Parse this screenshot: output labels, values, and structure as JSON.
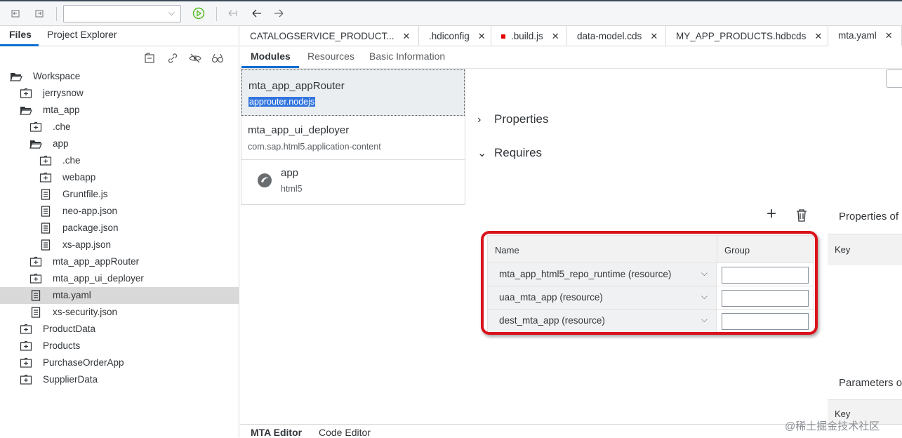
{
  "toolbar": {
    "icons": [
      "undo-icon",
      "redo-icon",
      "run-icon",
      "previous-edit-icon",
      "back-icon",
      "forward-icon"
    ],
    "selector_value": ""
  },
  "left_panel": {
    "tabs": [
      {
        "label": "Files",
        "active": true
      },
      {
        "label": "Project Explorer",
        "active": false
      }
    ],
    "tools": [
      "collapse-all-icon",
      "link-editor-icon",
      "hide-hidden-files-icon",
      "search-files-icon"
    ],
    "tree": [
      {
        "label": "Workspace",
        "type": "folder-open",
        "level": 0
      },
      {
        "label": "jerrysnow",
        "type": "project",
        "level": 1
      },
      {
        "label": "mta_app",
        "type": "folder-open",
        "level": 1
      },
      {
        "label": ".che",
        "type": "project",
        "level": 2
      },
      {
        "label": "app",
        "type": "folder-open",
        "level": 2
      },
      {
        "label": ".che",
        "type": "project",
        "level": 3
      },
      {
        "label": "webapp",
        "type": "project",
        "level": 3
      },
      {
        "label": "Gruntfile.js",
        "type": "file",
        "level": 3
      },
      {
        "label": "neo-app.json",
        "type": "file",
        "level": 3
      },
      {
        "label": "package.json",
        "type": "file",
        "level": 3
      },
      {
        "label": "xs-app.json",
        "type": "file",
        "level": 3
      },
      {
        "label": "mta_app_appRouter",
        "type": "project",
        "level": 2
      },
      {
        "label": "mta_app_ui_deployer",
        "type": "project",
        "level": 2
      },
      {
        "label": "mta.yaml",
        "type": "file",
        "level": 2,
        "selected": true
      },
      {
        "label": "xs-security.json",
        "type": "file",
        "level": 2
      },
      {
        "label": "ProductData",
        "type": "project",
        "level": 1
      },
      {
        "label": "Products",
        "type": "project",
        "level": 1
      },
      {
        "label": "PurchaseOrderApp",
        "type": "project",
        "level": 1
      },
      {
        "label": "SupplierData",
        "type": "project",
        "level": 1
      }
    ]
  },
  "editor_tabs": [
    {
      "label": "CATALOGSERVICE_PRODUCT...",
      "modified": false
    },
    {
      "label": ".hdiconfig",
      "modified": false
    },
    {
      "label": ".build.js",
      "modified": true
    },
    {
      "label": "data-model.cds",
      "modified": false
    },
    {
      "label": "MY_APP_PRODUCTS.hdbcds",
      "modified": false
    },
    {
      "label": "mta.yaml",
      "modified": false,
      "active": true
    }
  ],
  "mta_tabs": [
    {
      "label": "Modules",
      "active": true
    },
    {
      "label": "Resources",
      "active": false
    },
    {
      "label": "Basic Information",
      "active": false
    }
  ],
  "modules": [
    {
      "name": "mta_app_appRouter",
      "type": "approuter.nodejs",
      "selected": true
    },
    {
      "name": "mta_app_ui_deployer",
      "type": "com.sap.html5.application-content",
      "selected": false
    },
    {
      "name": "app",
      "type": "html5",
      "selected": false
    }
  ],
  "sections": {
    "properties": "Properties",
    "requires": "Requires"
  },
  "requires_table": {
    "headers": {
      "name": "Name",
      "group": "Group"
    },
    "rows": [
      {
        "name": "mta_app_html5_repo_runtime (resource)",
        "group": ""
      },
      {
        "name": "uaa_mta_app (resource)",
        "group": ""
      },
      {
        "name": "dest_mta_app (resource)",
        "group": ""
      }
    ]
  },
  "side_panel": {
    "properties_of": "Properties of",
    "key_header": "Key",
    "parameters_of": "Parameters o",
    "key_header_2": "Key"
  },
  "bottom_tabs": [
    {
      "label": "MTA Editor",
      "active": true
    },
    {
      "label": "Code Editor",
      "active": false
    }
  ],
  "watermark": "@稀土掘金技术社区",
  "colors": {
    "accent": "#0a6ed1",
    "highlight_box": "#d9121b",
    "selection_bg": "#3174de"
  }
}
